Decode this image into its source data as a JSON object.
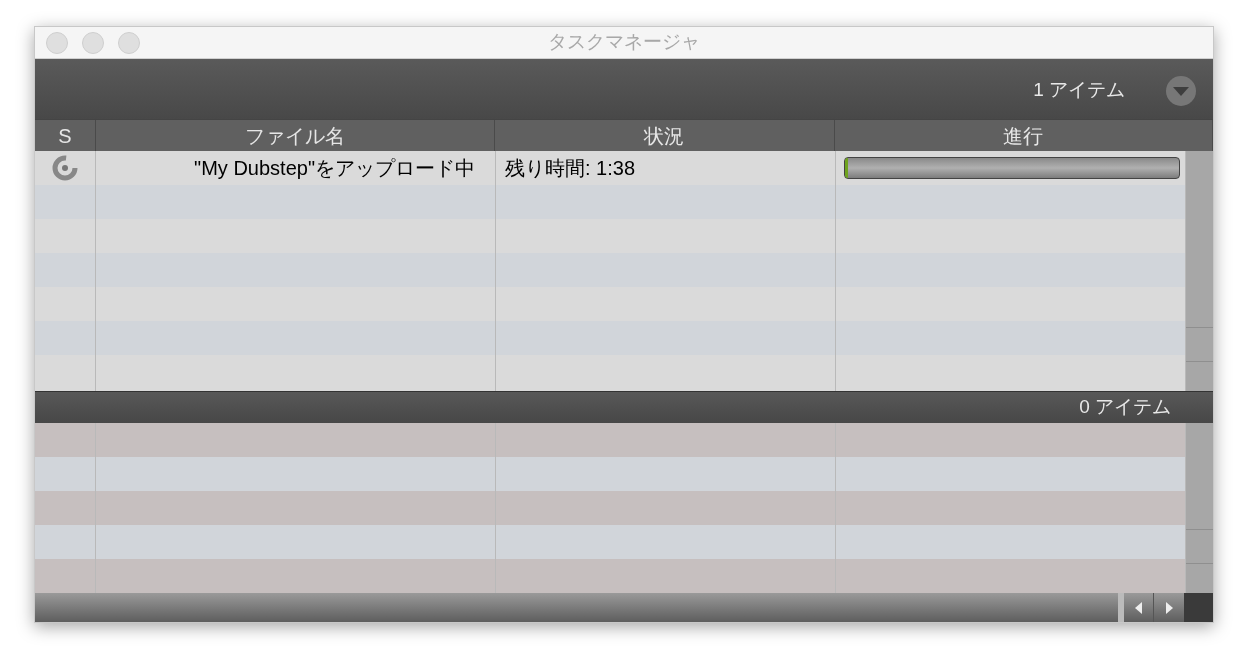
{
  "window": {
    "title": "タスクマネージャ"
  },
  "active": {
    "count": "1 アイテム"
  },
  "columns": [
    "S",
    "ファイル名",
    "状況",
    "進行"
  ],
  "rows": [
    {
      "file": "\"My Dubstep\"をアップロード中",
      "status": "残り時間: 1:38",
      "level": 0.006
    }
  ],
  "finished": {
    "count": "0 アイテム"
  }
}
